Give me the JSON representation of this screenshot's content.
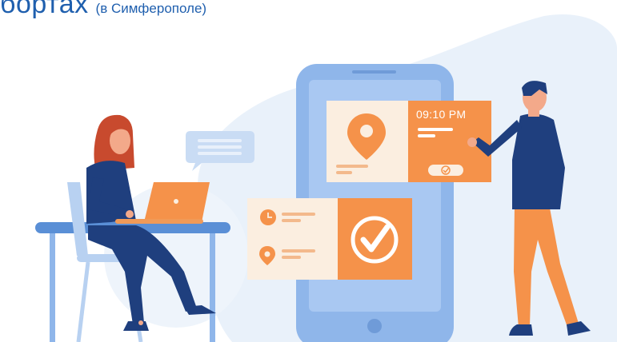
{
  "title": {
    "main": "бортах",
    "sub": "(в Симферополе)"
  },
  "card": {
    "time": "09:10 PM"
  },
  "colors": {
    "title_blue": "#1f5fae",
    "accent_orange": "#f5924a",
    "navy": "#1f3f7e",
    "phone_blue": "#8fb6ea",
    "bg_blob": "#e9f1fa",
    "card_cream": "#fbeee0"
  },
  "icons": [
    "map-pin-icon",
    "check-icon",
    "clock-icon",
    "chat-bubble-icon"
  ]
}
